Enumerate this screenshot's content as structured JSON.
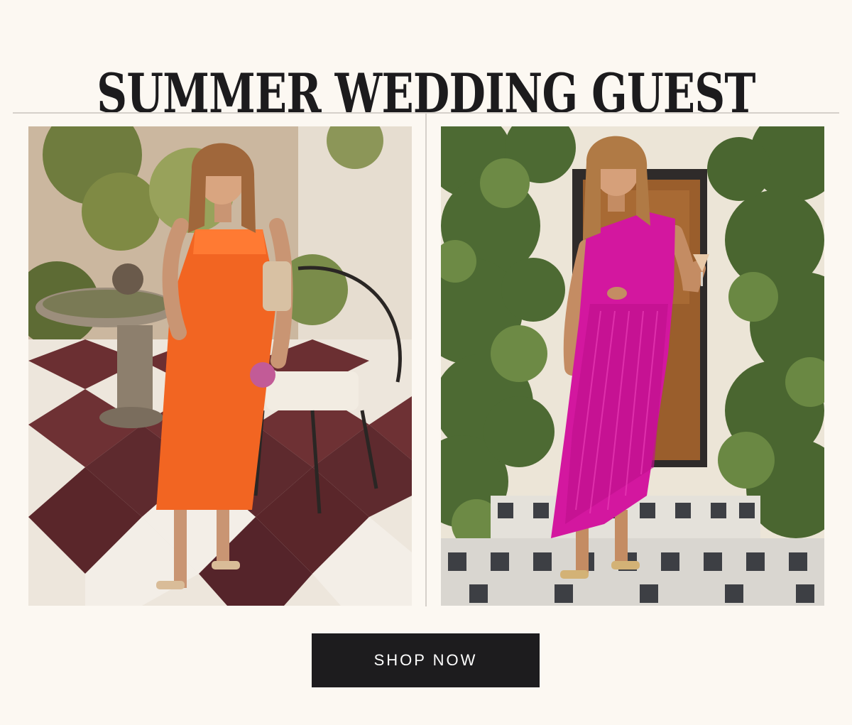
{
  "headline": "SUMMER WEDDING GUEST",
  "cta": {
    "label": "SHOP NOW"
  },
  "colors": {
    "background": "#fcf8f2",
    "divider": "#d5d0ca",
    "headline": "#1c1b1d",
    "button_bg": "#1d1c1e",
    "button_text": "#ffffff",
    "dress_left": "#f26522",
    "dress_right": "#d3179f"
  }
}
